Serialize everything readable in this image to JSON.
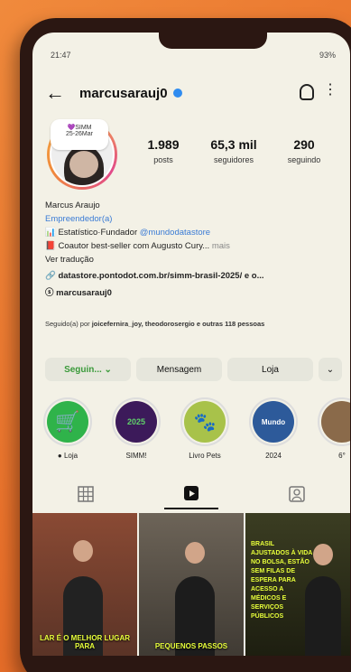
{
  "status_bar": {
    "time": "21:47",
    "right": "93%"
  },
  "header": {
    "username": "marcusarauj0"
  },
  "note": {
    "text": "💜SIMM\n25-26Mar"
  },
  "stats": [
    {
      "value": "1.989",
      "label": "posts"
    },
    {
      "value": "65,3 mil",
      "label": "seguidores"
    },
    {
      "value": "290",
      "label": "seguindo"
    }
  ],
  "bio": {
    "name": "Marcus Araujo",
    "category": "Empreendedor(a)",
    "line1_prefix": "📊 Estatístico·Fundador ",
    "line1_link": "@mundodatastore",
    "line2": "📕 Coautor best-seller com Augusto Cury...",
    "line2_more": "mais",
    "translate": "Ver tradução",
    "website": "🔗 datastore.pontodot.com.br/simm-brasil-2025/ e o...",
    "threads": "ⓢ marcusarauj0"
  },
  "followers": {
    "prefix": "Seguido(a) por ",
    "names": "joicefernira_joy, theodorosergio e outras 118 pessoas"
  },
  "buttons": {
    "follow": "Seguin... ⌄",
    "message": "Mensagem",
    "shop": "Loja",
    "more": "⌄"
  },
  "highlights": [
    {
      "label": "● Loja",
      "inner": "🛒",
      "color": "#2fb34a"
    },
    {
      "label": "SIMM!",
      "inner": "2025",
      "color": "#3c1a5a"
    },
    {
      "label": "Livro Pets",
      "inner": "🐾",
      "color": "#a8c24a"
    },
    {
      "label": "2024",
      "inner": "Mundo",
      "color": "#2d5a9a"
    },
    {
      "label": "6°",
      "inner": "",
      "color": "#8a6a4a"
    }
  ],
  "tabs": [
    {
      "name": "grid",
      "icon": "grid-icon"
    },
    {
      "name": "reels",
      "icon": "reels-icon"
    },
    {
      "name": "tagged",
      "icon": "tagged-icon"
    }
  ],
  "posts": [
    {
      "caption": "LAR É O MELHOR LUGAR PARA"
    },
    {
      "caption": "PEQUENOS PASSOS"
    },
    {
      "caption": "BRASIL AJUSTADOS À VIDA NO BOLSA, ESTÃO SEM FILAS DE ESPERA PARA ACESSO A MÉDICOS E SERVIÇOS PÚBLICOS"
    }
  ],
  "colors": {
    "accent_blue": "#3a7bd5",
    "verified": "#2f8cf0",
    "follow_green": "#3a9a3a",
    "highlight_yellow": "#e8ff3a",
    "background_orange": "#e8702a"
  }
}
